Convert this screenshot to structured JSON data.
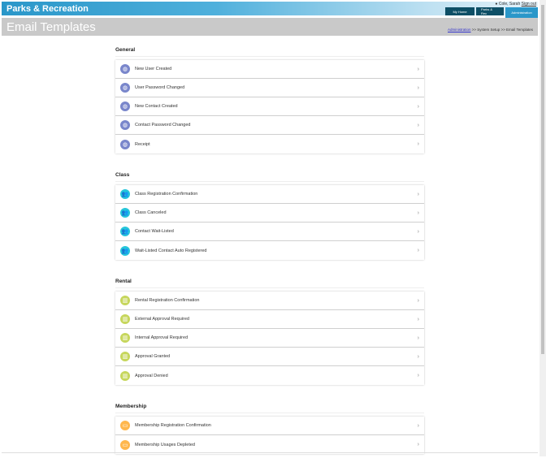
{
  "header": {
    "brand": "Parks & Recreation",
    "user": "Cole, Sarah",
    "signout": "Sign out",
    "nav": [
      "My Home",
      "Parks & Rec",
      "Administration"
    ]
  },
  "page": {
    "title": "Email Templates",
    "breadcrumb": {
      "link": "Administration",
      "rest": " >> System Setup >> Email Templates"
    }
  },
  "sections": [
    {
      "title": "General",
      "icon": "globe-icon",
      "color": "#7986cb",
      "items": [
        "New User Created",
        "User Password Changed",
        "New Contact Created",
        "Contact Password Changed",
        "Receipt"
      ]
    },
    {
      "title": "Class",
      "icon": "people-icon",
      "color": "#26c6da",
      "items": [
        "Class Registration Confirmation",
        "Class Canceled",
        "Contact Wait-Listed",
        "Wait-Listed Contact Auto Registered"
      ]
    },
    {
      "title": "Rental",
      "icon": "building-icon",
      "color": "#c6d65b",
      "items": [
        "Rental Registration Confirmation",
        "External Approval Required",
        "Internal Approval Required",
        "Approval Granted",
        "Approval Denied"
      ]
    },
    {
      "title": "Membership",
      "icon": "card-icon",
      "color": "#ffb74d",
      "items": [
        "Membership Registration Confirmation",
        "Membership Usages Depleted"
      ]
    }
  ]
}
